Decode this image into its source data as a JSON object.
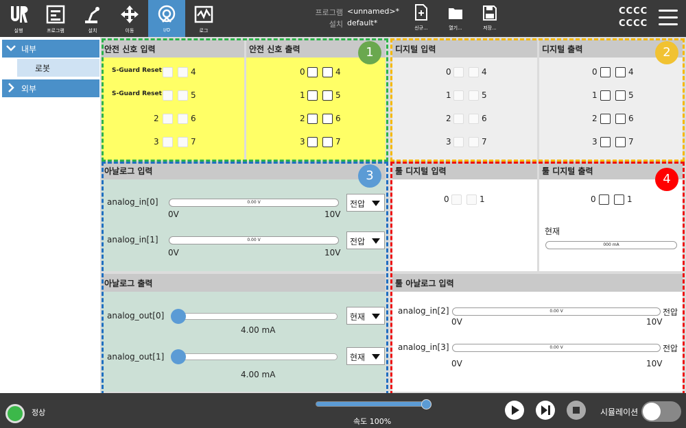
{
  "nav": [
    {
      "label": "실행",
      "icon": "ur-logo-icon"
    },
    {
      "label": "프로그램",
      "icon": "program-icon"
    },
    {
      "label": "설치",
      "icon": "installation-icon"
    },
    {
      "label": "이동",
      "icon": "move-icon"
    },
    {
      "label": "I/O",
      "icon": "io-icon"
    },
    {
      "label": "로그",
      "icon": "log-icon"
    }
  ],
  "program": {
    "program_key": "프로그램",
    "program_value": "<unnamed>*",
    "install_key": "설치",
    "install_value": "default*"
  },
  "file": [
    {
      "label": "신규...",
      "icon": "new-file-icon"
    },
    {
      "label": "열기...",
      "icon": "folder-icon"
    },
    {
      "label": "저장...",
      "icon": "save-icon"
    }
  ],
  "user": {
    "line1": "CCCC",
    "line2": "CCCC"
  },
  "sidebar": {
    "internal": "내부",
    "robot": "로봇",
    "external": "외부"
  },
  "safety_in": {
    "title": "안전 신호 입력",
    "row1_label": "S-Guard Reset",
    "row2_label": "S-Guard Reset",
    "r1": "4",
    "r2": "5",
    "l3": "2",
    "r3": "6",
    "l4": "3",
    "r4": "7"
  },
  "safety_out": {
    "title": "안전 신호 출력",
    "rows": [
      [
        "0",
        "4"
      ],
      [
        "1",
        "5"
      ],
      [
        "2",
        "6"
      ],
      [
        "3",
        "7"
      ]
    ]
  },
  "digital_in": {
    "title": "디지털 입력",
    "rows": [
      [
        "0",
        "4"
      ],
      [
        "1",
        "5"
      ],
      [
        "2",
        "6"
      ],
      [
        "3",
        "7"
      ]
    ]
  },
  "digital_out": {
    "title": "디지털 출력",
    "rows": [
      [
        "0",
        "4"
      ],
      [
        "1",
        "5"
      ],
      [
        "2",
        "6"
      ],
      [
        "3",
        "7"
      ]
    ]
  },
  "analog_in": {
    "title": "아날로그 입력",
    "ch0": {
      "name": "analog_in[0]",
      "value": "0.00 V",
      "min": "0V",
      "max": "10V",
      "mode": "전압"
    },
    "ch1": {
      "name": "analog_in[1]",
      "value": "0.00 V",
      "min": "0V",
      "max": "10V",
      "mode": "전압"
    }
  },
  "analog_out": {
    "title": "아날로그 출력",
    "ch0": {
      "name": "analog_out[0]",
      "value": "4.00 mA",
      "mode": "현재"
    },
    "ch1": {
      "name": "analog_out[1]",
      "value": "4.00 mA",
      "mode": "현재"
    }
  },
  "tool_din": {
    "title": "툴 디지털 입력",
    "a": "0",
    "b": "1"
  },
  "tool_dout": {
    "title": "툴 디지털 출력",
    "a": "0",
    "b": "1",
    "current_label": "현재",
    "current_value": "000 mA"
  },
  "tool_ain": {
    "title": "툴 아날로그 입력",
    "ch2": {
      "name": "analog_in[2]",
      "value": "0.00 V",
      "min": "0V",
      "max": "10V",
      "mode": "전압"
    },
    "ch3": {
      "name": "analog_in[3]",
      "value": "0.00 V",
      "min": "0V",
      "max": "10V",
      "mode": "전압"
    }
  },
  "badges": [
    "1",
    "2",
    "3",
    "4"
  ],
  "colors": {
    "badge1": "#6aa84f",
    "badge2": "#f1c232",
    "badge3": "#5b9bd5",
    "badge4": "#ff0000"
  },
  "bottom": {
    "status": "정상",
    "speed": "속도 100%",
    "speed_percent": 100,
    "simulation": "시뮬레이션"
  }
}
